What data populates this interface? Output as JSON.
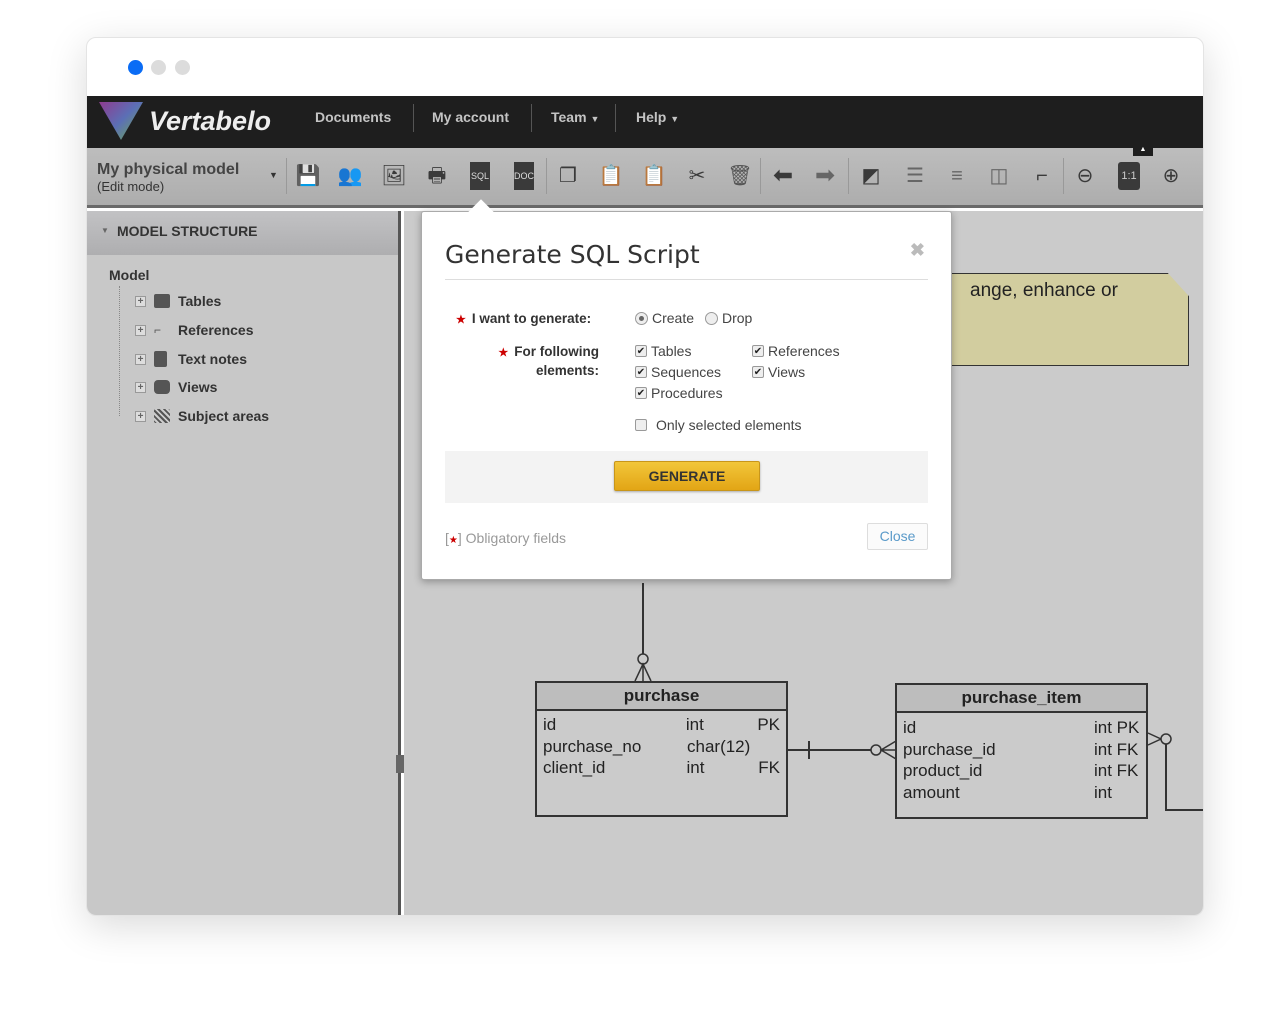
{
  "window": {
    "dots": [
      "#0a6cf5",
      "#dcdcdc",
      "#dcdcdc"
    ]
  },
  "nav": {
    "logo": "Vertabelo",
    "items": [
      "Documents",
      "My account",
      "Team",
      "Help"
    ]
  },
  "toolbar": {
    "model_name": "My physical model",
    "mode": "(Edit mode)",
    "icons": [
      "save-icon",
      "users-icon",
      "image-icon",
      "print-icon",
      "sql-icon",
      "doc-icon",
      "copy-icon",
      "paste-icon",
      "paste-special-icon",
      "cut-icon",
      "trash-icon",
      "undo-icon",
      "redo-icon",
      "edit-line-icon",
      "align-icon",
      "distribute-icon",
      "arrange-icon",
      "route-icon",
      "zoom-out-icon",
      "zoom-reset-icon",
      "zoom-in-icon"
    ],
    "sql": "SQL",
    "doc": "DOC",
    "zoom_reset": "1:1"
  },
  "sidebar": {
    "header": "MODEL STRUCTURE",
    "root": "Model",
    "items": [
      {
        "label": "Tables",
        "icon": "table-icon"
      },
      {
        "label": "References",
        "icon": "reference-icon"
      },
      {
        "label": "Text notes",
        "icon": "text-note-icon"
      },
      {
        "label": "Views",
        "icon": "view-icon"
      },
      {
        "label": "Subject areas",
        "icon": "subject-area-icon"
      }
    ]
  },
  "canvas": {
    "note": "ange, enhance or",
    "entities": [
      {
        "name": "purchase",
        "columns": [
          [
            "id",
            "int",
            "PK"
          ],
          [
            "purchase_no",
            "char(12)",
            ""
          ],
          [
            "client_id",
            "int",
            "FK"
          ]
        ]
      },
      {
        "name": "purchase_item",
        "columns": [
          [
            "id",
            "int PK"
          ],
          [
            "purchase_id",
            "int FK"
          ],
          [
            "product_id",
            "int FK"
          ],
          [
            "amount",
            "int"
          ]
        ]
      }
    ]
  },
  "dialog": {
    "title": "Generate SQL Script",
    "generate_label": "I want to generate:",
    "create": "Create",
    "drop": "Drop",
    "selected_mode": "Create",
    "elements_label_1": "For following",
    "elements_label_2": "elements:",
    "elements": [
      {
        "label": "Tables",
        "checked": true
      },
      {
        "label": "References",
        "checked": true
      },
      {
        "label": "Sequences",
        "checked": true
      },
      {
        "label": "Views",
        "checked": true
      },
      {
        "label": "Procedures",
        "checked": true
      }
    ],
    "only_selected": "Only selected elements",
    "only_selected_checked": false,
    "generate_button": "GENERATE",
    "obligatory_open": "[",
    "obligatory_close": "] Obligatory fields",
    "close_button": "Close"
  }
}
